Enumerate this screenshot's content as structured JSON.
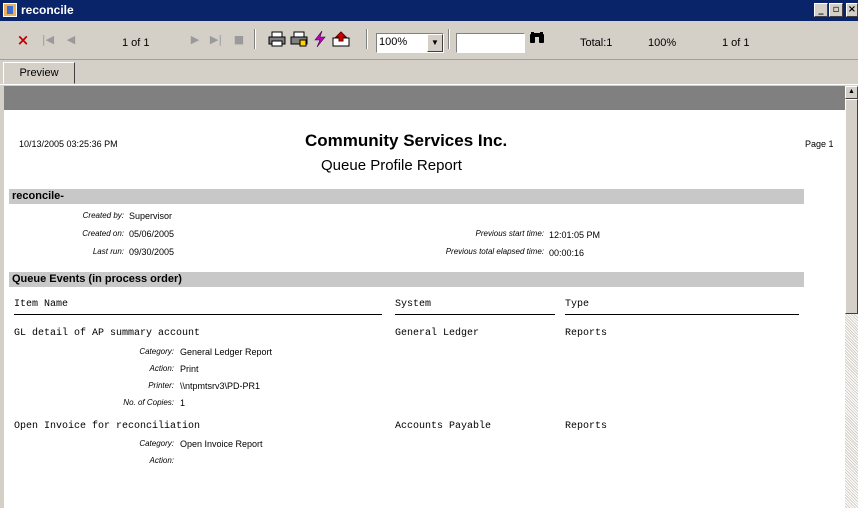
{
  "window": {
    "title": "reconcile"
  },
  "toolbar": {
    "page_indicator": "1 of 1",
    "zoom_value": "100%",
    "search_value": "",
    "total_label": "Total:1",
    "percent_label": "100%",
    "page_count": "1 of 1"
  },
  "tabs": [
    "Preview"
  ],
  "report": {
    "timestamp": "10/13/2005  03:25:36 PM",
    "company": "Community Services Inc.",
    "title": "Queue Profile Report",
    "page_label": "Page 1",
    "section_name": "reconcile-",
    "fields": {
      "created_by_label": "Created by:",
      "created_by_value": "Supervisor",
      "created_on_label": "Created on:",
      "created_on_value": "05/06/2005",
      "last_run_label": "Last run:",
      "last_run_value": "09/30/2005",
      "prev_start_label": "Previous start time:",
      "prev_start_value": "12:01:05 PM",
      "prev_elapsed_label": "Previous total elapsed time:",
      "prev_elapsed_value": "00:00:16"
    },
    "events_header": "Queue Events (in process order)",
    "columns": [
      "Item Name",
      "System",
      "Type"
    ],
    "events": [
      {
        "name": "GL detail of AP summary account",
        "system": "General Ledger",
        "type": "Reports",
        "details": [
          {
            "label": "Category:",
            "value": "General Ledger Report"
          },
          {
            "label": "Action:",
            "value": "Print"
          },
          {
            "label": "Printer:",
            "value": "\\\\ntpmtsrv3\\PD-PR1"
          },
          {
            "label": "No. of Copies:",
            "value": "1"
          }
        ]
      },
      {
        "name": "Open Invoice for reconciliation",
        "system": "Accounts Payable",
        "type": "Reports",
        "details": [
          {
            "label": "Category:",
            "value": "Open Invoice Report"
          },
          {
            "label": "Action:",
            "value": ""
          }
        ]
      }
    ]
  }
}
